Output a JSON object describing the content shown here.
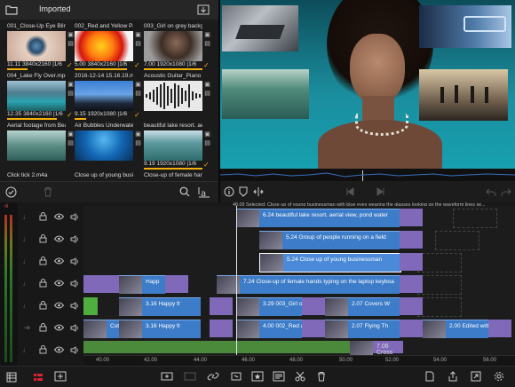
{
  "library": {
    "title": "Imported",
    "tiles": [
      {
        "name": "001_Close-Up Eye Blinking",
        "res": "11.11 3840x2160 |1/6",
        "bar": 0.35
      },
      {
        "name": "002_Red and Yellow Paint",
        "res": "5.00 3840x2160 |1/6",
        "bar": 0.9
      },
      {
        "name": "003_Girl on grey backgroun",
        "res": "7.00 1920x1080 |1/6",
        "bar": 1.0
      },
      {
        "name": "004_Lake Fly Over.mp4",
        "res": "12.35 3840x2160 |1/6",
        "bar": 0.85
      },
      {
        "name": "2016-12-14 15.16.19.mp4",
        "res": "9.15 1920x1080 |1/6",
        "bar": 0.2
      },
      {
        "name": "Acoustic Guitar_Piano Und",
        "res": "",
        "bar": 0.0
      },
      {
        "name": "Aerial footage from Beautif",
        "res": "",
        "bar": 0.0
      },
      {
        "name": "Air Bubbles Underwater.m",
        "res": "",
        "bar": 0.0
      },
      {
        "name": "beautiful lake resort. aeri",
        "res": "9.19 1920x1080 |1/6",
        "bar": 1.0
      },
      {
        "name": "Click tick 2.m4a",
        "res": "",
        "bar": 0.0
      },
      {
        "name": "Close up of young busines",
        "res": "",
        "bar": 0.0
      },
      {
        "name": "Close-up of female hands",
        "res": "",
        "bar": 0.0
      }
    ]
  },
  "viewer": {
    "caption": "48.09 Selected: Close up of young businessman with blue eyes wearing the glasses looking on the waveform lines se..."
  },
  "timeline": {
    "ruler": [
      "40.00",
      "42.00",
      "44.00",
      "46.00",
      "48.00",
      "50.00",
      "52.00",
      "54.00",
      "56.00"
    ],
    "level_label": "-6",
    "clips": [
      {
        "row": 0,
        "label": "6.24  beautiful lake resort. aerial view, pond water"
      },
      {
        "row": 1,
        "label": "5.24  Group of people running on a field"
      },
      {
        "row": 2,
        "label": "5.24  Close up of young businessman"
      },
      {
        "row": 3,
        "label": "7.24  Close-up of female hands typing on the laptop keyboa"
      },
      {
        "row": 4,
        "label": "3.29  003_Girl on grey"
      },
      {
        "row": 5,
        "label": "4.00  002_Red a"
      },
      {
        "row": 6,
        "label": "7.06  Cross Dissolv"
      },
      {
        "row": 4,
        "label": "2.07  Covers W"
      },
      {
        "row": 5,
        "label": "2.07  Flying Th"
      },
      {
        "row": 5,
        "label": "2.00  Edited with"
      },
      {
        "row": 3,
        "label": "Happ"
      },
      {
        "row": 4,
        "label": "3.16  Happy fr"
      },
      {
        "row": 5,
        "label": "3.16  Happy fr"
      },
      {
        "row": 5,
        "label": "Cute rel"
      }
    ],
    "small_values": [
      "0.26",
      "1.00",
      "0.28",
      "1.00",
      "1.00",
      "0.28",
      "1.00",
      "1.00",
      "0.28",
      "1.00",
      "0.26"
    ]
  }
}
